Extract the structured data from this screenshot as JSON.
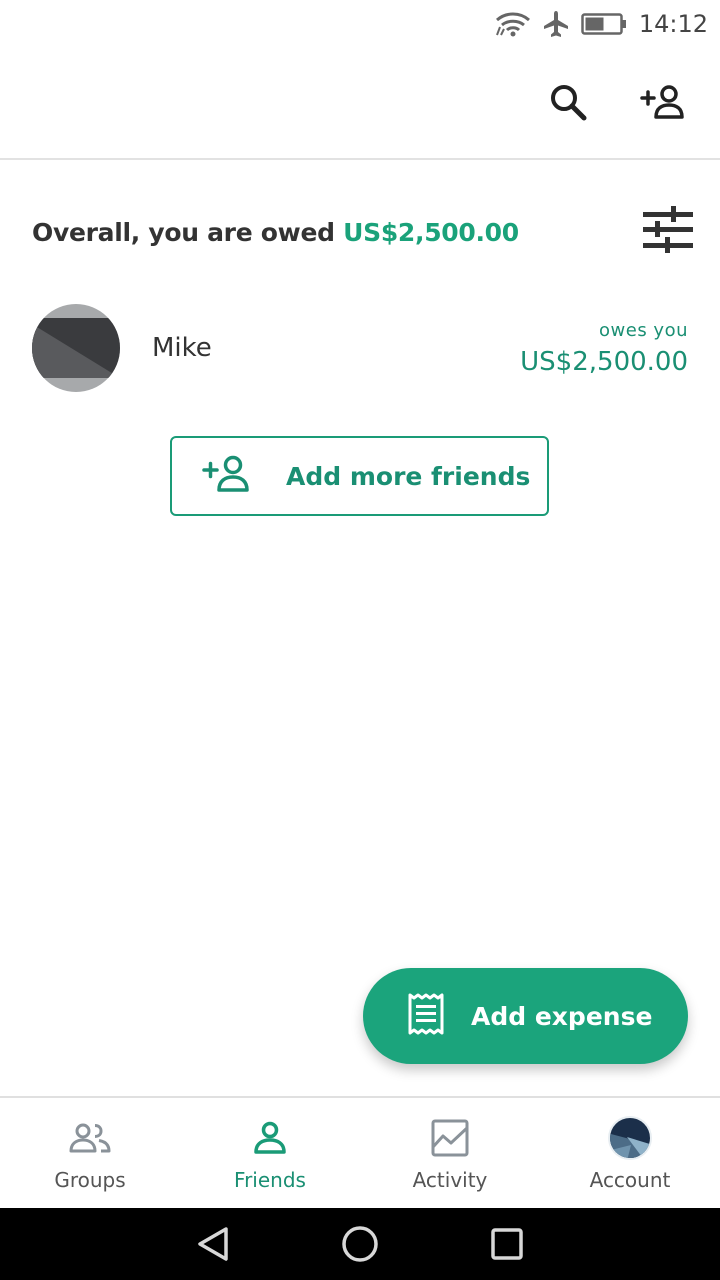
{
  "status_bar": {
    "time": "14:12",
    "icons": [
      "wifi-icon",
      "airplane-icon",
      "battery-icon"
    ]
  },
  "header": {
    "icons": [
      "search-icon",
      "add-person-icon"
    ]
  },
  "summary": {
    "prefix": "Overall, you are owed ",
    "amount": "US$2,500.00",
    "filter_icon": "sliders-icon"
  },
  "friends": [
    {
      "name": "Mike",
      "balance_label": "owes you",
      "balance_amount": "US$2,500.00"
    }
  ],
  "add_more": {
    "label": "Add more friends",
    "icon": "add-person-icon"
  },
  "fab": {
    "label": "Add expense",
    "icon": "receipt-icon"
  },
  "bottom_nav": {
    "items": [
      {
        "label": "Groups",
        "icon": "groups-icon",
        "active": false
      },
      {
        "label": "Friends",
        "icon": "person-icon",
        "active": true
      },
      {
        "label": "Activity",
        "icon": "chart-icon",
        "active": false
      },
      {
        "label": "Account",
        "icon": "account-avatar",
        "active": false
      }
    ]
  },
  "system_nav": {
    "icons": [
      "back-icon",
      "home-icon",
      "recents-icon"
    ]
  },
  "colors": {
    "accent": "#1aa27a",
    "accent_dark": "#1a8f73",
    "text": "#333333"
  }
}
